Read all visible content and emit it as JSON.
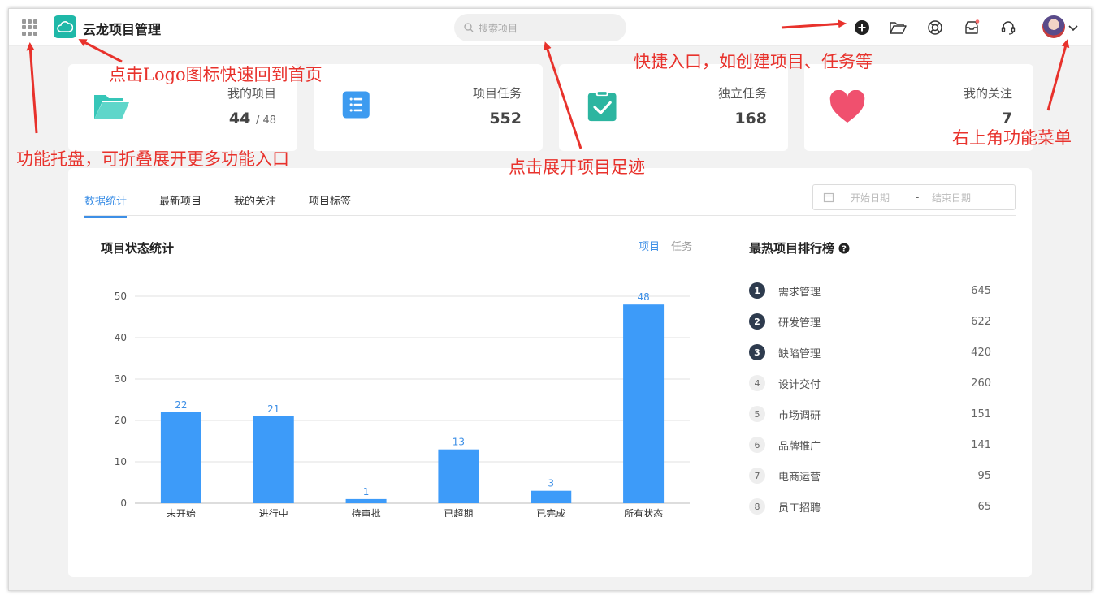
{
  "header": {
    "app_title": "云龙项目管理",
    "search_placeholder": "搜索项目",
    "icons": [
      "apps-grid-icon",
      "logo-cloud-icon",
      "search-icon",
      "add-circle-icon",
      "folder-open-icon",
      "lifebuoy-icon",
      "inbox-icon",
      "headset-icon",
      "user-avatar",
      "chevron-down-icon"
    ],
    "notification_dot_color": "#f56c6c"
  },
  "stats": [
    {
      "label": "我的项目",
      "value": "44",
      "sub": "/ 48",
      "icon": "folder-icon",
      "color": "#36c6b8"
    },
    {
      "label": "项目任务",
      "value": "552",
      "sub": "",
      "icon": "list-icon",
      "color": "#3d9bf0"
    },
    {
      "label": "独立任务",
      "value": "168",
      "sub": "",
      "icon": "clipboard-check-icon",
      "color": "#2cb5a0"
    },
    {
      "label": "我的关注",
      "value": "7",
      "sub": "",
      "icon": "heart-icon",
      "color": "#f0506e"
    }
  ],
  "tabs": [
    {
      "label": "数据统计",
      "active": true
    },
    {
      "label": "最新项目",
      "active": false
    },
    {
      "label": "我的关注",
      "active": false
    },
    {
      "label": "项目标签",
      "active": false
    }
  ],
  "date_range": {
    "start_placeholder": "开始日期",
    "separator": "-",
    "end_placeholder": "结束日期"
  },
  "chart_title": "项目状态统计",
  "chart_toggle": {
    "on": "项目",
    "off": "任务"
  },
  "chart_data": {
    "type": "bar",
    "categories": [
      "未开始",
      "进行中",
      "待审批",
      "已超期",
      "已完成",
      "所有状态"
    ],
    "values": [
      22,
      21,
      1,
      13,
      3,
      48
    ],
    "yticks": [
      0,
      10,
      20,
      30,
      40,
      50
    ],
    "ylim": [
      0,
      50
    ],
    "grid": true,
    "bar_color": "#3d9bf9",
    "label_color": "#3d8fe6"
  },
  "ranking": {
    "title": "最热项目排行榜",
    "items": [
      {
        "rank": "1",
        "name": "需求管理",
        "count": "645"
      },
      {
        "rank": "2",
        "name": "研发管理",
        "count": "622"
      },
      {
        "rank": "3",
        "name": "缺陷管理",
        "count": "420"
      },
      {
        "rank": "4",
        "name": "设计交付",
        "count": "260"
      },
      {
        "rank": "5",
        "name": "市场调研",
        "count": "151"
      },
      {
        "rank": "6",
        "name": "品牌推广",
        "count": "141"
      },
      {
        "rank": "7",
        "name": "电商运营",
        "count": "95"
      },
      {
        "rank": "8",
        "name": "员工招聘",
        "count": "65"
      }
    ]
  },
  "annotations": {
    "logo_tip": "点击Logo图标快速回到首页",
    "shortcut_tip": "快捷入口，如创建项目、任务等",
    "tray_tip": "功能托盘，可折叠展开更多功能入口",
    "search_tip": "点击展开项目足迹",
    "menu_tip": "右上角功能菜单",
    "color": "#e8322c"
  }
}
